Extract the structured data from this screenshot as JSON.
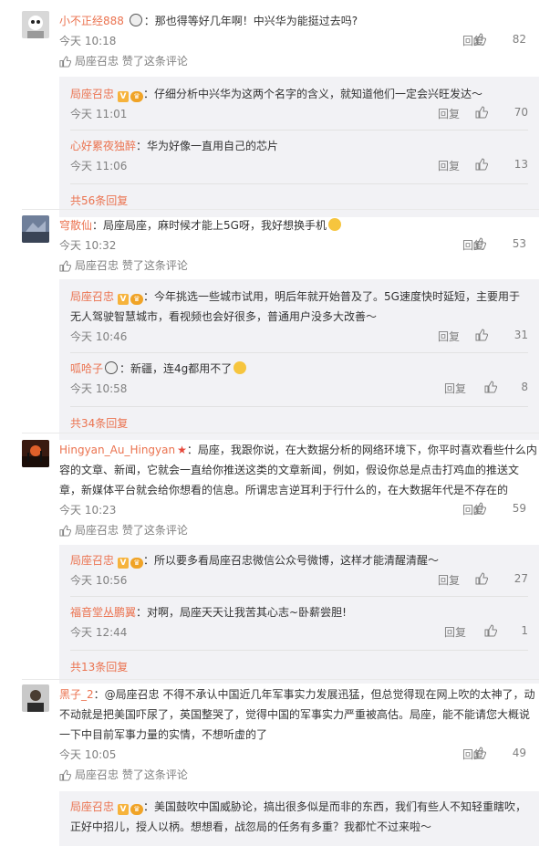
{
  "actions": {
    "reply_label": "回复",
    "liked_by_text": "局座召忠 赞了这条评论"
  },
  "comments": [
    {
      "user": "小不正经888",
      "text": "那也得等好几年啊！中兴华为能挺过去吗?",
      "time": "今天 10:18",
      "likes": "82",
      "replies": [
        {
          "user": "局座召忠",
          "text": "仔细分析中兴华为这两个名字的含义，就知道他们一定会兴旺发达～",
          "time": "今天 11:01",
          "likes": "70"
        },
        {
          "user": "心好累夜独醉",
          "text": "华为好像一直用自己的芯片",
          "time": "今天 11:06",
          "likes": "13"
        }
      ],
      "more": "共56条回复"
    },
    {
      "user": "穹散仙",
      "text": "局座局座，麻时候才能上5G呀，我好想换手机",
      "time": "今天 10:32",
      "likes": "53",
      "replies": [
        {
          "user": "局座召忠",
          "text": "今年挑选一些城市试用，明后年就开始普及了。5G速度快时延短，主要用于无人驾驶智慧城市，看视频也会好很多，普通用户没多大改善～",
          "time": "今天 10:46",
          "likes": "31"
        },
        {
          "user": "呱哈子",
          "text": "新疆，连4g都用不了",
          "time": "今天 10:58",
          "likes": "8"
        }
      ],
      "more": "共34条回复"
    },
    {
      "user": "Hingyan_Au_Hingyan",
      "text": "局座，我跟你说，在大数据分析的网络环境下，你平时喜欢看些什么内容的文章、新闻，它就会一直给你推送这类的文章新闻，例如，假设你总是点击打鸡血的推送文章，新媒体平台就会给你想看的信息。所谓忠言逆耳利于行什么的，在大数据年代是不存在的",
      "time": "今天 10:23",
      "likes": "59",
      "replies": [
        {
          "user": "局座召忠",
          "text": "所以要多看局座召忠微信公众号微博，这样才能清醒清醒～",
          "time": "今天 10:56",
          "likes": "27"
        },
        {
          "user": "福音堂丛鹏翼",
          "text": "对啊，局座天天让我苦其心志~卧薪尝胆!",
          "time": "今天 12:44",
          "likes": "1"
        }
      ],
      "more": "共13条回复"
    },
    {
      "user": "黑子_2",
      "text": "@局座召忠 不得不承认中国近几年军事实力发展迅猛，但总觉得现在网上吹的太神了，动不动就是把美国吓尿了，英国整哭了，觉得中国的军事实力严重被高估。局座，能不能请您大概说一下中目前军事力量的实情，不想听虚的了",
      "time": "今天 10:05",
      "likes": "49",
      "replies": [
        {
          "user": "局座召忠",
          "text": "美国鼓吹中国威胁论，搞出很多似是而非的东西，我们有些人不知轻重瞎吹，正好中招儿，授人以柄。想想看，战忽局的任务有多重？我都忙不过来啦～",
          "time": "",
          "likes": ""
        }
      ],
      "more": ""
    }
  ],
  "colors": {
    "username": "#eb7350",
    "meta": "#808080",
    "reply_box_bg": "#f2f2f5"
  },
  "icons": [
    "thumbs-up-icon",
    "verified-v-icon",
    "level-badge-icon",
    "star-icon",
    "panda-emoji-icon",
    "crying-emoji-icon",
    "face-emoji-icon"
  ]
}
